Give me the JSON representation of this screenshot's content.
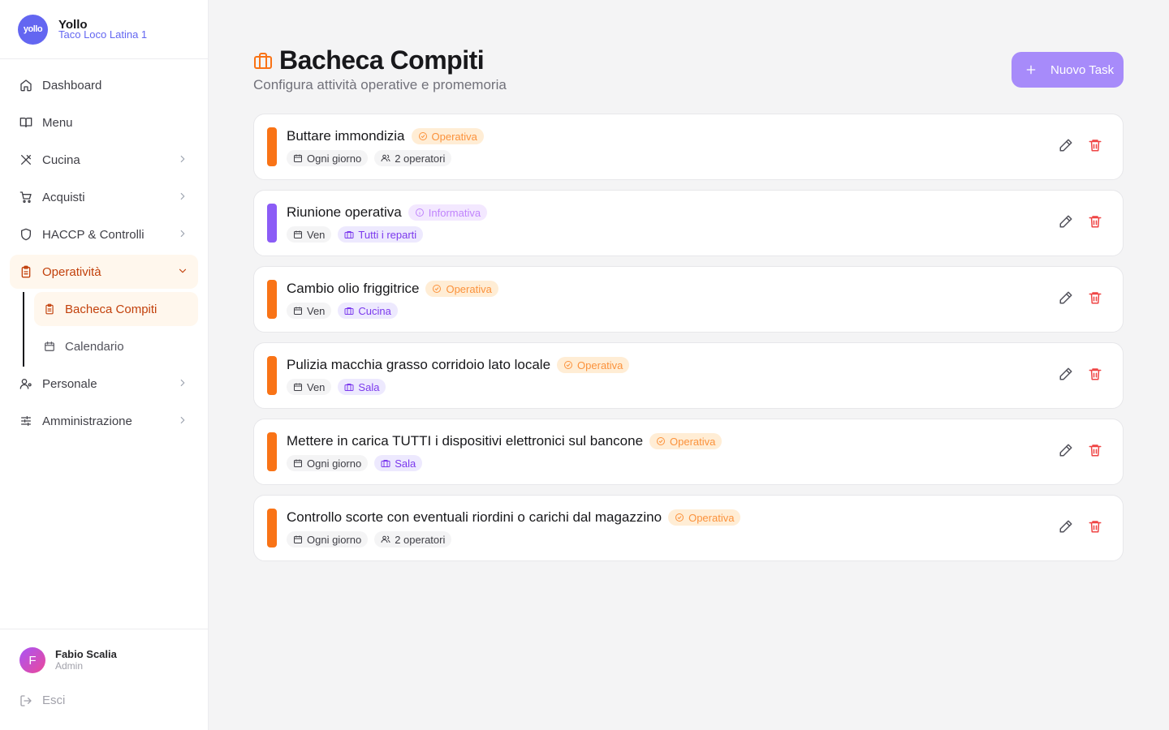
{
  "brand": {
    "logo_text": "yollo",
    "name": "Yollo",
    "sub": "Taco Loco Latina 1"
  },
  "sidebar": {
    "items": [
      {
        "label": "Dashboard",
        "icon": "home-icon"
      },
      {
        "label": "Menu",
        "icon": "book-open-icon"
      },
      {
        "label": "Cucina",
        "icon": "utensils-icon"
      },
      {
        "label": "Acquisti",
        "icon": "cart-icon"
      },
      {
        "label": "HACCP & Controlli",
        "icon": "shield-icon"
      },
      {
        "label": "Operatività",
        "icon": "clipboard-icon"
      },
      {
        "label": "Personale",
        "icon": "user-icon"
      },
      {
        "label": "Amministrazione",
        "icon": "sliders-icon"
      }
    ],
    "sub_items": [
      {
        "label": "Bacheca Compiti",
        "icon": "clipboard-list-icon"
      },
      {
        "label": "Calendario",
        "icon": "calendar-icon"
      }
    ]
  },
  "user": {
    "initial": "F",
    "name": "Fabio Scalia",
    "role": "Admin",
    "logout": "Esci"
  },
  "page": {
    "title": "Bacheca Compiti",
    "subtitle": "Configura attività operative e promemoria",
    "new_button": "Nuovo Task"
  },
  "colors": {
    "accent": "#f97316",
    "primary": "#a78bfa",
    "informativa": "#8b5cf6",
    "danger": "#ef4444"
  },
  "tasks": [
    {
      "title": "Buttare immondizia",
      "type": "Operativa",
      "schedule": "Ogni giorno",
      "assign": "2 operatori"
    },
    {
      "title": "Riunione operativa",
      "type": "Informativa",
      "schedule": "Ven",
      "assign": "Tutti i reparti"
    },
    {
      "title": "Cambio olio friggitrice",
      "type": "Operativa",
      "schedule": "Ven",
      "assign": "Cucina"
    },
    {
      "title": "Pulizia macchia grasso corridoio lato locale",
      "type": "Operativa",
      "schedule": "Ven",
      "assign": "Sala"
    },
    {
      "title": "Mettere in carica TUTTI i dispositivi elettronici sul bancone",
      "type": "Operativa",
      "schedule": "Ogni giorno",
      "assign": "Sala"
    },
    {
      "title": "Controllo scorte con eventuali riordini o carichi dal magazzino",
      "type": "Operativa",
      "schedule": "Ogni giorno",
      "assign": "2 operatori"
    }
  ]
}
